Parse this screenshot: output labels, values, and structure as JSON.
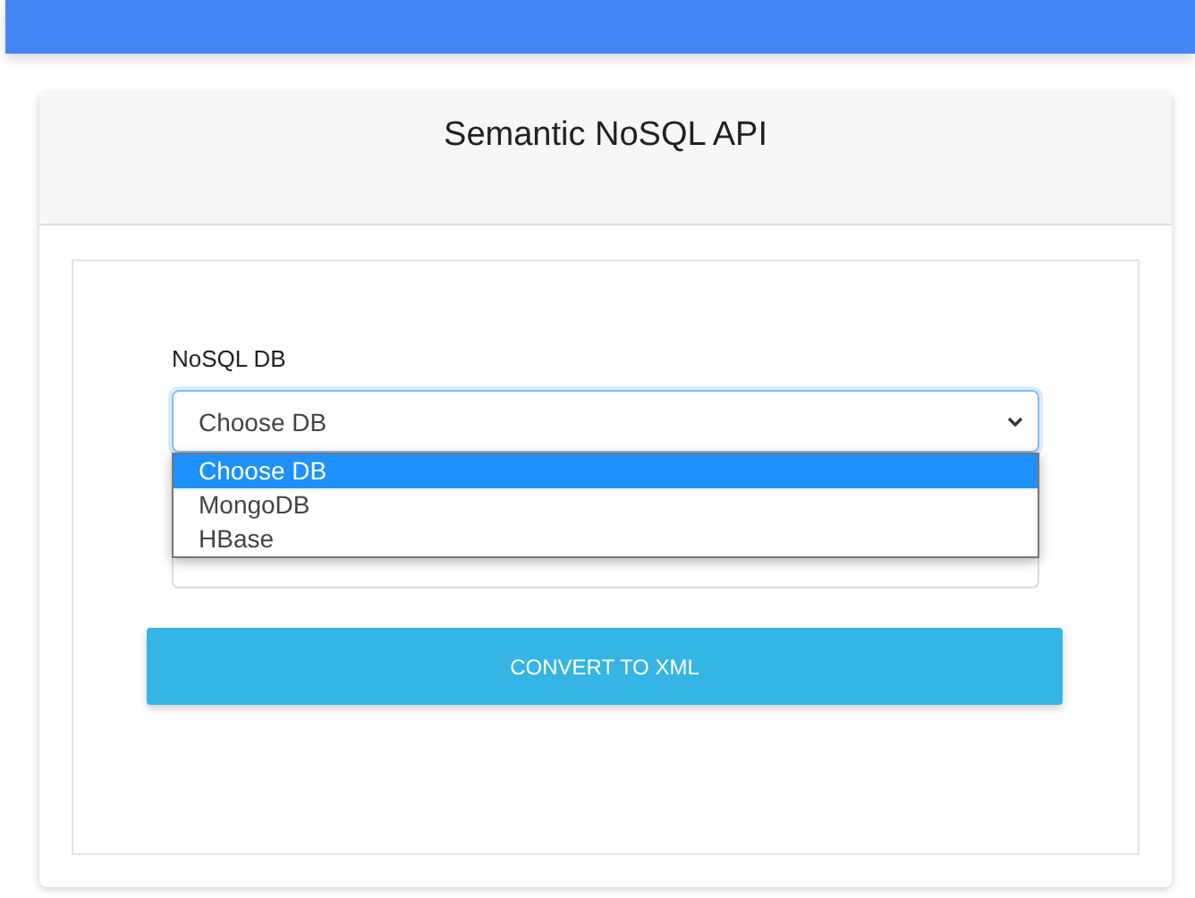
{
  "header": {
    "title": "Semantic NoSQL API"
  },
  "form": {
    "label": "NoSQL DB",
    "select": {
      "value": "Choose DB",
      "expanded": true,
      "options": [
        {
          "label": "Choose DB",
          "selected": true
        },
        {
          "label": "MongoDB",
          "selected": false
        },
        {
          "label": "HBase",
          "selected": false
        }
      ]
    }
  },
  "button": {
    "label": "CONVERT TO XML"
  }
}
